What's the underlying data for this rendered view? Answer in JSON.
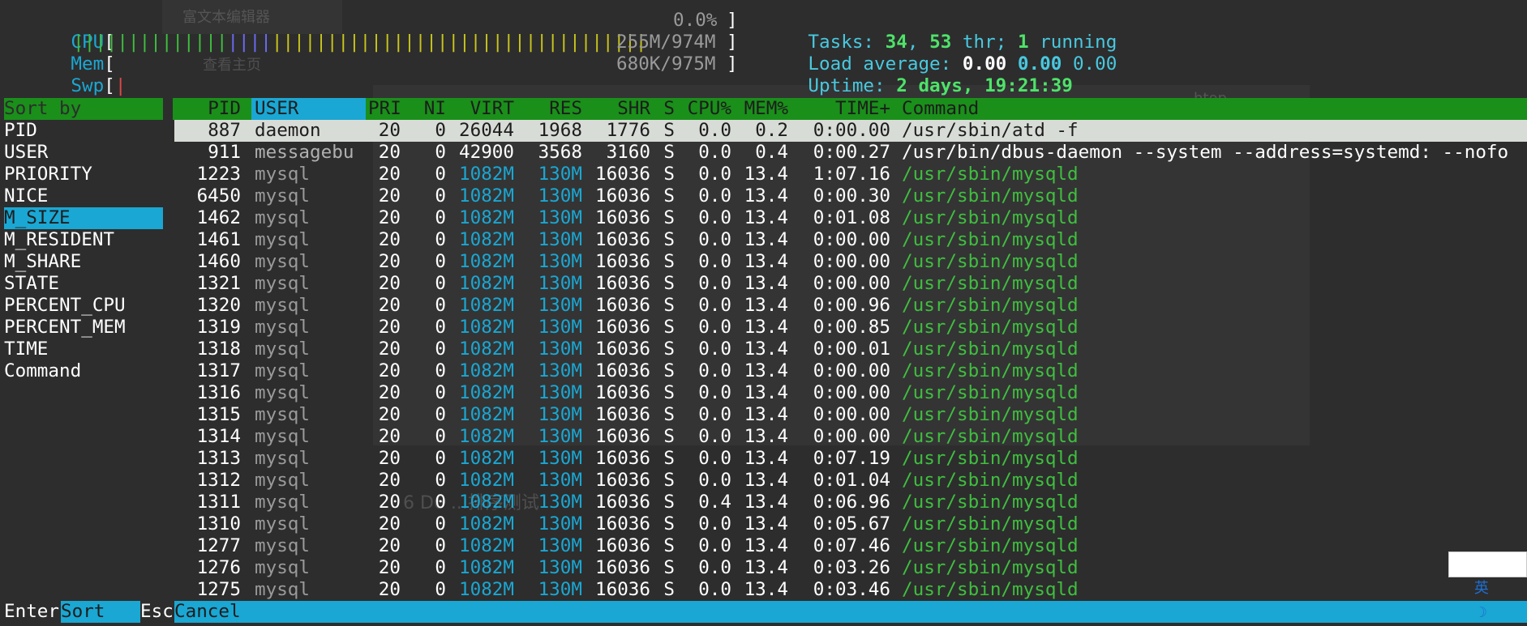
{
  "meters": {
    "cpu": {
      "label": "CPU",
      "value": "0.0%"
    },
    "mem": {
      "label": "Mem",
      "value": "255M/974M"
    },
    "swp": {
      "label": "Swp",
      "value": "680K/975M"
    }
  },
  "summary": {
    "tasks_label": "Tasks:",
    "tasks": "34",
    "thr": "53",
    "thr_label": "thr;",
    "running": "1",
    "running_label": "running",
    "load_label": "Load average:",
    "load1": "0.00",
    "load5": "0.00",
    "load15": "0.00",
    "uptime_label": "Uptime:",
    "uptime": "2 days, 19:21:39"
  },
  "sort_panel": {
    "title": "Sort by",
    "items": [
      "PID",
      "USER",
      "PRIORITY",
      "NICE",
      "M_SIZE",
      "M_RESIDENT",
      "M_SHARE",
      "STATE",
      "PERCENT_CPU",
      "PERCENT_MEM",
      "TIME",
      "Command"
    ],
    "selected": "M_SIZE"
  },
  "columns": [
    "PID",
    "USER",
    "PRI",
    "NI",
    "VIRT",
    "RES",
    "SHR",
    "S",
    "CPU%",
    "MEM%",
    "TIME+",
    "Command"
  ],
  "processes": [
    {
      "pid": "887",
      "user": "daemon",
      "pri": "20",
      "ni": "0",
      "virt": "26044",
      "res": "1968",
      "shr": "1776",
      "s": "S",
      "cpu": "0.0",
      "mem": "0.2",
      "time": "0:00.00",
      "cmd": "/usr/sbin/atd -f"
    },
    {
      "pid": "911",
      "user": "messagebu",
      "pri": "20",
      "ni": "0",
      "virt": "42900",
      "res": "3568",
      "shr": "3160",
      "s": "S",
      "cpu": "0.0",
      "mem": "0.4",
      "time": "0:00.27",
      "cmd": "/usr/bin/dbus-daemon --system --address=systemd: --nofo"
    },
    {
      "pid": "1223",
      "user": "mysql",
      "pri": "20",
      "ni": "0",
      "virt": "1082M",
      "res": "130M",
      "shr": "16036",
      "s": "S",
      "cpu": "0.0",
      "mem": "13.4",
      "time": "1:07.16",
      "cmd": "/usr/sbin/mysqld"
    },
    {
      "pid": "6450",
      "user": "mysql",
      "pri": "20",
      "ni": "0",
      "virt": "1082M",
      "res": "130M",
      "shr": "16036",
      "s": "S",
      "cpu": "0.0",
      "mem": "13.4",
      "time": "0:00.30",
      "cmd": "/usr/sbin/mysqld"
    },
    {
      "pid": "1462",
      "user": "mysql",
      "pri": "20",
      "ni": "0",
      "virt": "1082M",
      "res": "130M",
      "shr": "16036",
      "s": "S",
      "cpu": "0.0",
      "mem": "13.4",
      "time": "0:01.08",
      "cmd": "/usr/sbin/mysqld"
    },
    {
      "pid": "1461",
      "user": "mysql",
      "pri": "20",
      "ni": "0",
      "virt": "1082M",
      "res": "130M",
      "shr": "16036",
      "s": "S",
      "cpu": "0.0",
      "mem": "13.4",
      "time": "0:00.00",
      "cmd": "/usr/sbin/mysqld"
    },
    {
      "pid": "1460",
      "user": "mysql",
      "pri": "20",
      "ni": "0",
      "virt": "1082M",
      "res": "130M",
      "shr": "16036",
      "s": "S",
      "cpu": "0.0",
      "mem": "13.4",
      "time": "0:00.00",
      "cmd": "/usr/sbin/mysqld"
    },
    {
      "pid": "1321",
      "user": "mysql",
      "pri": "20",
      "ni": "0",
      "virt": "1082M",
      "res": "130M",
      "shr": "16036",
      "s": "S",
      "cpu": "0.0",
      "mem": "13.4",
      "time": "0:00.00",
      "cmd": "/usr/sbin/mysqld"
    },
    {
      "pid": "1320",
      "user": "mysql",
      "pri": "20",
      "ni": "0",
      "virt": "1082M",
      "res": "130M",
      "shr": "16036",
      "s": "S",
      "cpu": "0.0",
      "mem": "13.4",
      "time": "0:00.96",
      "cmd": "/usr/sbin/mysqld"
    },
    {
      "pid": "1319",
      "user": "mysql",
      "pri": "20",
      "ni": "0",
      "virt": "1082M",
      "res": "130M",
      "shr": "16036",
      "s": "S",
      "cpu": "0.0",
      "mem": "13.4",
      "time": "0:00.85",
      "cmd": "/usr/sbin/mysqld"
    },
    {
      "pid": "1318",
      "user": "mysql",
      "pri": "20",
      "ni": "0",
      "virt": "1082M",
      "res": "130M",
      "shr": "16036",
      "s": "S",
      "cpu": "0.0",
      "mem": "13.4",
      "time": "0:00.01",
      "cmd": "/usr/sbin/mysqld"
    },
    {
      "pid": "1317",
      "user": "mysql",
      "pri": "20",
      "ni": "0",
      "virt": "1082M",
      "res": "130M",
      "shr": "16036",
      "s": "S",
      "cpu": "0.0",
      "mem": "13.4",
      "time": "0:00.00",
      "cmd": "/usr/sbin/mysqld"
    },
    {
      "pid": "1316",
      "user": "mysql",
      "pri": "20",
      "ni": "0",
      "virt": "1082M",
      "res": "130M",
      "shr": "16036",
      "s": "S",
      "cpu": "0.0",
      "mem": "13.4",
      "time": "0:00.00",
      "cmd": "/usr/sbin/mysqld"
    },
    {
      "pid": "1315",
      "user": "mysql",
      "pri": "20",
      "ni": "0",
      "virt": "1082M",
      "res": "130M",
      "shr": "16036",
      "s": "S",
      "cpu": "0.0",
      "mem": "13.4",
      "time": "0:00.00",
      "cmd": "/usr/sbin/mysqld"
    },
    {
      "pid": "1314",
      "user": "mysql",
      "pri": "20",
      "ni": "0",
      "virt": "1082M",
      "res": "130M",
      "shr": "16036",
      "s": "S",
      "cpu": "0.0",
      "mem": "13.4",
      "time": "0:00.00",
      "cmd": "/usr/sbin/mysqld"
    },
    {
      "pid": "1313",
      "user": "mysql",
      "pri": "20",
      "ni": "0",
      "virt": "1082M",
      "res": "130M",
      "shr": "16036",
      "s": "S",
      "cpu": "0.0",
      "mem": "13.4",
      "time": "0:07.19",
      "cmd": "/usr/sbin/mysqld"
    },
    {
      "pid": "1312",
      "user": "mysql",
      "pri": "20",
      "ni": "0",
      "virt": "1082M",
      "res": "130M",
      "shr": "16036",
      "s": "S",
      "cpu": "0.0",
      "mem": "13.4",
      "time": "0:01.04",
      "cmd": "/usr/sbin/mysqld"
    },
    {
      "pid": "1311",
      "user": "mysql",
      "pri": "20",
      "ni": "0",
      "virt": "1082M",
      "res": "130M",
      "shr": "16036",
      "s": "S",
      "cpu": "0.4",
      "mem": "13.4",
      "time": "0:06.96",
      "cmd": "/usr/sbin/mysqld"
    },
    {
      "pid": "1310",
      "user": "mysql",
      "pri": "20",
      "ni": "0",
      "virt": "1082M",
      "res": "130M",
      "shr": "16036",
      "s": "S",
      "cpu": "0.0",
      "mem": "13.4",
      "time": "0:05.67",
      "cmd": "/usr/sbin/mysqld"
    },
    {
      "pid": "1277",
      "user": "mysql",
      "pri": "20",
      "ni": "0",
      "virt": "1082M",
      "res": "130M",
      "shr": "16036",
      "s": "S",
      "cpu": "0.0",
      "mem": "13.4",
      "time": "0:07.46",
      "cmd": "/usr/sbin/mysqld"
    },
    {
      "pid": "1276",
      "user": "mysql",
      "pri": "20",
      "ni": "0",
      "virt": "1082M",
      "res": "130M",
      "shr": "16036",
      "s": "S",
      "cpu": "0.0",
      "mem": "13.4",
      "time": "0:03.26",
      "cmd": "/usr/sbin/mysqld"
    },
    {
      "pid": "1275",
      "user": "mysql",
      "pri": "20",
      "ni": "0",
      "virt": "1082M",
      "res": "130M",
      "shr": "16036",
      "s": "S",
      "cpu": "0.0",
      "mem": "13.4",
      "time": "0:03.46",
      "cmd": "/usr/sbin/mysqld"
    }
  ],
  "footer": {
    "key1": "Enter",
    "label1": "Sort",
    "key2": "Esc",
    "label2": "Cancel"
  },
  "ime": {
    "text": "英"
  },
  "ghost": {
    "editor_tab": "富文本编辑器",
    "home_link": "查看主页",
    "section_title": "6 D6 ...排序测试",
    "htop_label": "htop"
  },
  "colors": {
    "background": "#2d2d2d",
    "cyan": "#1aa7d3",
    "header_green": "#1a8f1a",
    "command_green": "#3fbf3f",
    "selected_row": "#d8dcd6"
  }
}
